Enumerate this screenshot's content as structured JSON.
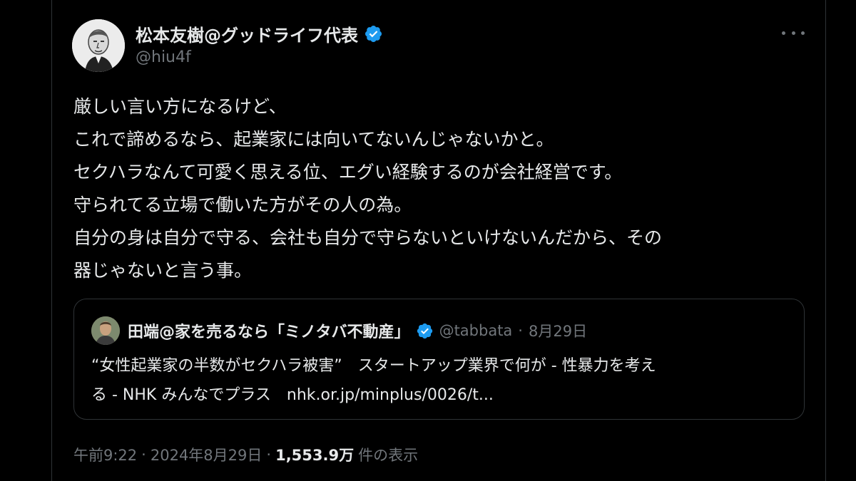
{
  "author": {
    "display_name": "松本友樹@グッドライフ代表",
    "handle": "@hiu4f",
    "verified_icon": "verified-badge-icon"
  },
  "tweet": {
    "lines": [
      "厳しい言い方になるけど、",
      "これで諦めるなら、起業家には向いてないんじゃないかと。",
      "セクハラなんて可愛く思える位、エグい経験するのが会社経営です。",
      "守られてる立場で働いた方がその人の為。",
      "自分の身は自分で守る、会社も自分で守らないといけないんだから、その",
      "器じゃないと言う事。"
    ]
  },
  "quote": {
    "display_name": "田端@家を売るなら「ミノタバ不動産」",
    "handle": "@tabbata",
    "separator": "·",
    "date": "8月29日",
    "lines": [
      "“女性起業家の半数がセクハラ被害”　スタートアップ業界で何が - 性暴力を考え",
      "る - NHK みんなでプラス　nhk.or.jp/minplus/0026/t..."
    ]
  },
  "footer": {
    "time": "午前9:22",
    "sep1": "·",
    "date": "2024年8月29日",
    "sep2": "·",
    "views_count": "1,553.9万",
    "views_label": "件の表示"
  },
  "colors": {
    "background": "#000000",
    "text_primary": "#e7e9ea",
    "text_secondary": "#71767b",
    "border": "#2f3336",
    "verified_blue": "#1d9bf0"
  }
}
